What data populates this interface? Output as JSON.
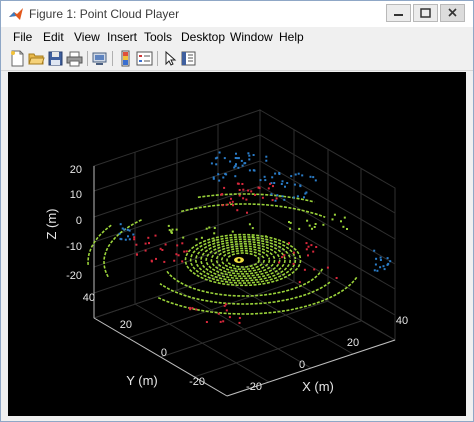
{
  "window": {
    "title": "Figure 1: Point Cloud Player",
    "controls": {
      "minimize": "minimize",
      "maximize": "maximize",
      "close": "close"
    }
  },
  "menubar": [
    "File",
    "Edit",
    "View",
    "Insert",
    "Tools",
    "Desktop",
    "Window",
    "Help"
  ],
  "toolbar": {
    "icons": [
      "new-figure-icon",
      "open-file-icon",
      "save-icon",
      "print-icon",
      "link-icon",
      "colorbar-icon",
      "legend-icon",
      "select-arrow-icon",
      "property-inspector-icon"
    ]
  },
  "plot": {
    "background": "#000000",
    "axis_color": "#e6e6e6",
    "point_colors": {
      "ground": "#9bd43a",
      "obstacle": "#d8283c",
      "far": "#2a7cc8"
    },
    "z_axis": {
      "label": "Z (m)",
      "ticks": [
        "20",
        "10",
        "0",
        "-10",
        "-20"
      ]
    },
    "y_axis": {
      "label": "Y (m)",
      "ticks": [
        "40",
        "20",
        "0",
        "-20"
      ]
    },
    "x_axis": {
      "label": "X (m)",
      "ticks": [
        "-20",
        "0",
        "20",
        "40"
      ]
    }
  }
}
